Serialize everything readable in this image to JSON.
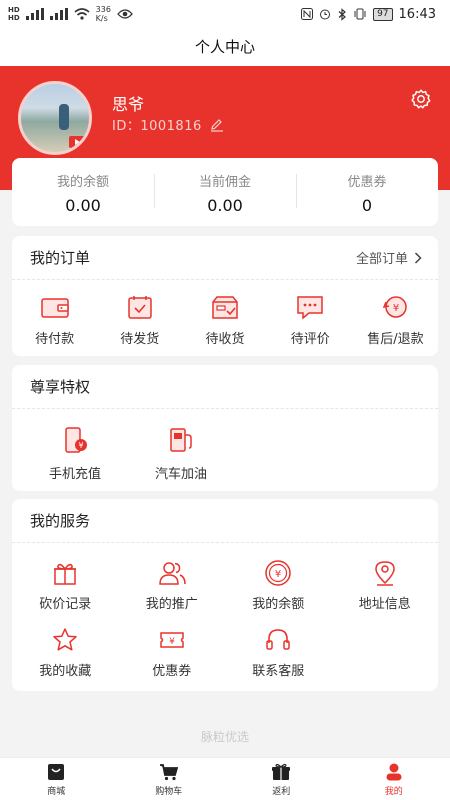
{
  "status_bar": {
    "sim1": "HD",
    "sim2": "HD",
    "network_speed_value": "336",
    "network_speed_unit": "K/s",
    "battery": "97",
    "time": "16:43"
  },
  "header": {
    "title": "个人中心"
  },
  "profile": {
    "name": "思爷",
    "id_text": "ID：1001816"
  },
  "balances": [
    {
      "label": "我的余额",
      "value": "0.00"
    },
    {
      "label": "当前佣金",
      "value": "0.00"
    },
    {
      "label": "优惠券",
      "value": "0"
    }
  ],
  "orders": {
    "title": "我的订单",
    "all_link": "全部订单",
    "items": [
      {
        "label": "待付款",
        "icon": "wallet-icon"
      },
      {
        "label": "待发货",
        "icon": "calendar-check-icon"
      },
      {
        "label": "待收货",
        "icon": "box-check-icon"
      },
      {
        "label": "待评价",
        "icon": "comment-icon"
      },
      {
        "label": "售后/退款",
        "icon": "refund-icon"
      }
    ]
  },
  "privileges": {
    "title": "尊享特权",
    "items": [
      {
        "label": "手机充值",
        "icon": "phone-recharge-icon"
      },
      {
        "label": "汽车加油",
        "icon": "fuel-pump-icon"
      }
    ]
  },
  "services": {
    "title": "我的服务",
    "items": [
      {
        "label": "砍价记录",
        "icon": "gift-icon"
      },
      {
        "label": "我的推广",
        "icon": "users-icon"
      },
      {
        "label": "我的余额",
        "icon": "coin-icon"
      },
      {
        "label": "地址信息",
        "icon": "location-icon"
      },
      {
        "label": "我的收藏",
        "icon": "star-icon"
      },
      {
        "label": "优惠券",
        "icon": "coupon-icon"
      },
      {
        "label": "联系客服",
        "icon": "headset-icon"
      }
    ]
  },
  "footer_brand": "脉粒优选",
  "tabbar": {
    "items": [
      {
        "label": "商城",
        "icon": "shop-icon"
      },
      {
        "label": "购物车",
        "icon": "cart-icon"
      },
      {
        "label": "返利",
        "icon": "rebate-gift-icon"
      },
      {
        "label": "我的",
        "icon": "user-icon"
      }
    ],
    "active": "我的"
  },
  "colors": {
    "brand_red": "#e8332d",
    "background": "#f3f3f3"
  }
}
